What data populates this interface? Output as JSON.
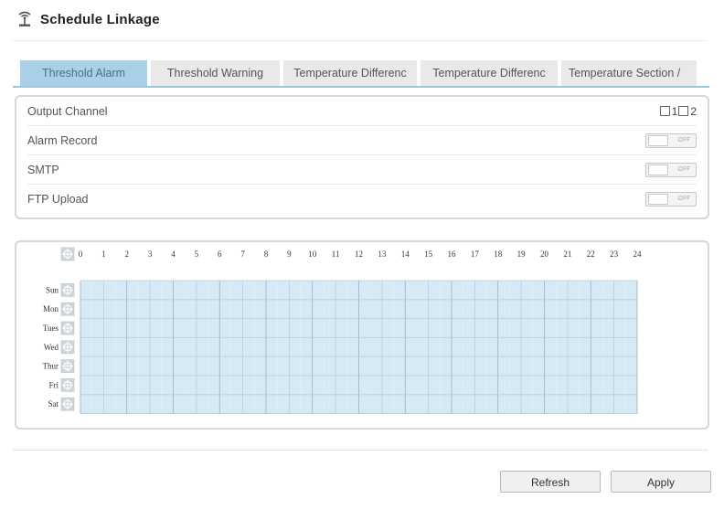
{
  "page": {
    "title": "Schedule Linkage"
  },
  "tabs": [
    {
      "label": "Threshold Alarm",
      "active": true
    },
    {
      "label": "Threshold Warning",
      "active": false
    },
    {
      "label": "Temperature Differenc",
      "active": false
    },
    {
      "label": "Temperature Differenc",
      "active": false
    },
    {
      "label": "Temperature Section /",
      "active": false
    }
  ],
  "settings": {
    "output_channel": {
      "label": "Output Channel",
      "channels": [
        "1",
        "2"
      ]
    },
    "alarm_record": {
      "label": "Alarm Record",
      "state": "OFF"
    },
    "smtp": {
      "label": "SMTP",
      "state": "OFF"
    },
    "ftp_upload": {
      "label": "FTP Upload",
      "state": "OFF"
    }
  },
  "schedule": {
    "hours": [
      "0",
      "1",
      "2",
      "3",
      "4",
      "5",
      "6",
      "7",
      "8",
      "9",
      "10",
      "11",
      "12",
      "13",
      "14",
      "15",
      "16",
      "17",
      "18",
      "19",
      "20",
      "21",
      "22",
      "23",
      "24"
    ],
    "days": [
      "Sun",
      "Mon",
      "Tues",
      "Wed",
      "Thur",
      "Fri",
      "Sat"
    ],
    "fill_color": "#d6eaf5"
  },
  "buttons": {
    "refresh": "Refresh",
    "apply": "Apply"
  },
  "icons": {
    "title": "broadcast-antenna-icon",
    "select_all": "crosshair-icon"
  }
}
